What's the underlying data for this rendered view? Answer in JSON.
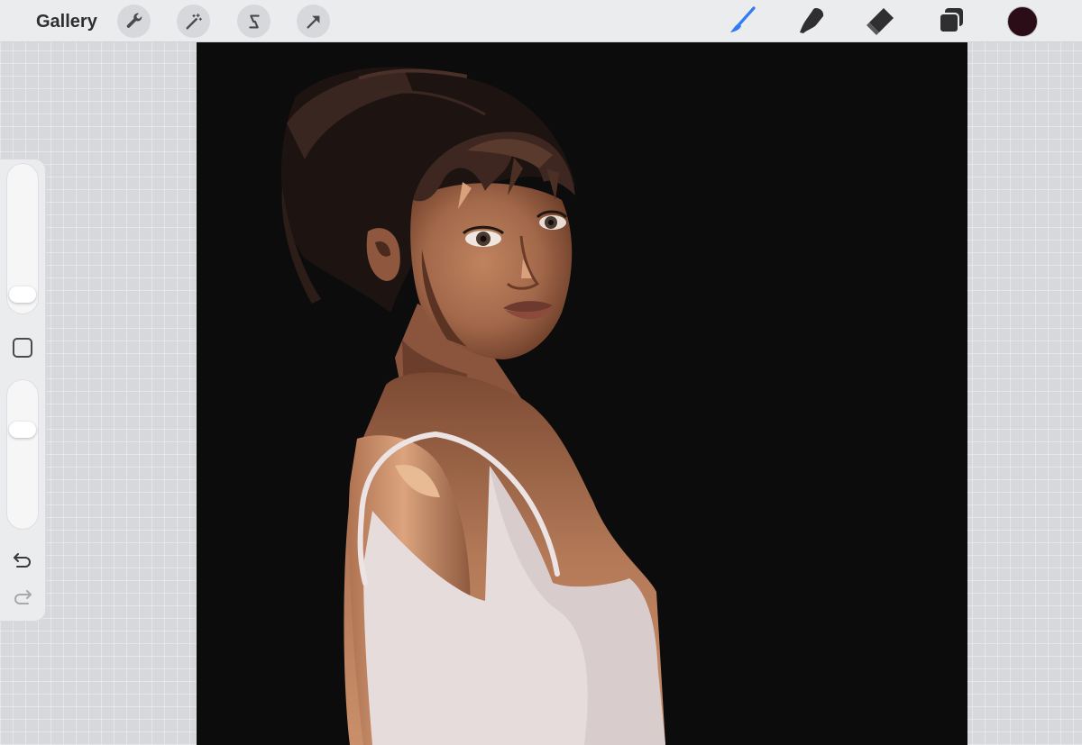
{
  "toolbar": {
    "gallery_label": "Gallery",
    "left_tools": [
      {
        "name": "actions",
        "icon": "wrench-icon"
      },
      {
        "name": "adjustments",
        "icon": "magic-wand-icon"
      },
      {
        "name": "selection",
        "icon": "selection-s-icon"
      },
      {
        "name": "transform",
        "icon": "arrow-cursor-icon"
      }
    ],
    "right_tools": [
      {
        "name": "brush",
        "icon": "brush-icon",
        "active": true
      },
      {
        "name": "smudge",
        "icon": "smudge-icon"
      },
      {
        "name": "eraser",
        "icon": "eraser-icon"
      },
      {
        "name": "layers",
        "icon": "layers-icon"
      }
    ],
    "active_color": "#2a0d17",
    "accent_color": "#2f7cf6"
  },
  "sidebar": {
    "brush_size_level": 0.08,
    "opacity_level": 0.7,
    "icons": [
      "modify-square-icon",
      "undo-icon",
      "redo-icon"
    ]
  },
  "canvas": {
    "background_color": "#0c0c0c",
    "artwork": "painted-portrait-woman"
  }
}
